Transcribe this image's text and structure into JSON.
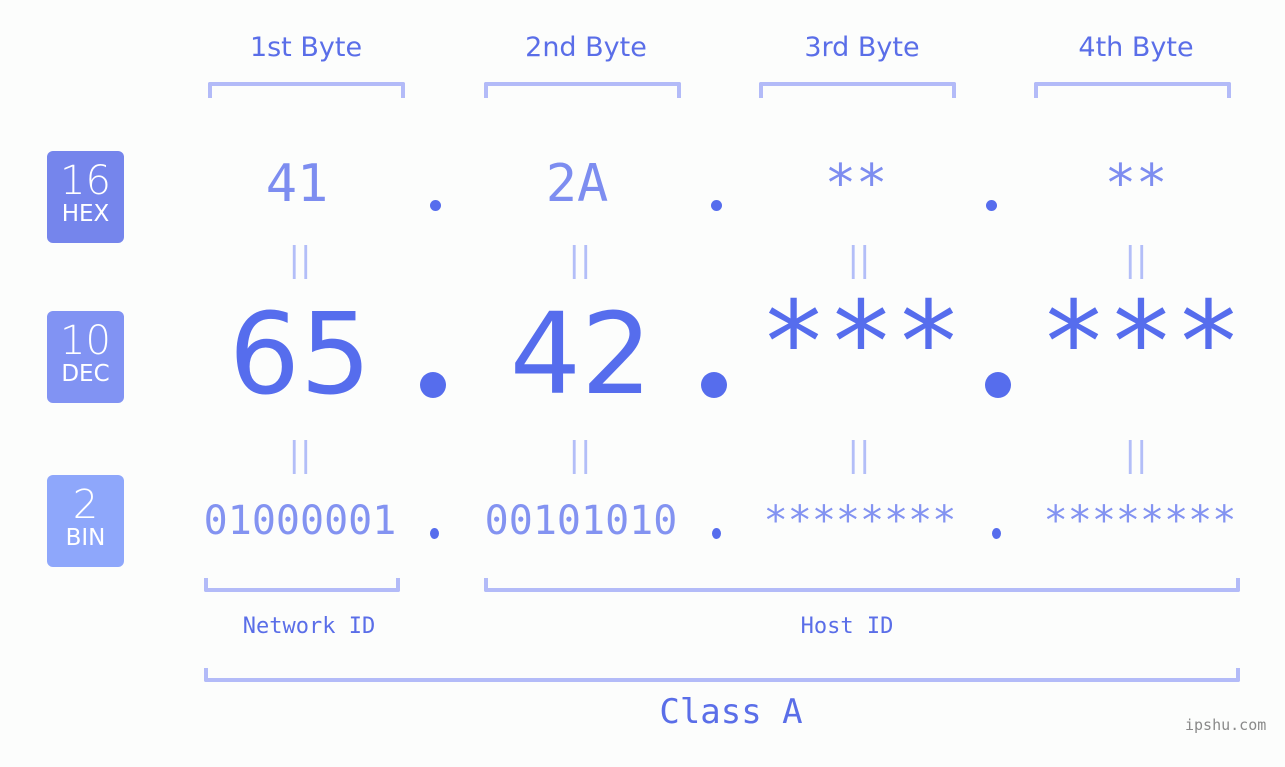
{
  "bytes": [
    {
      "header": "1st Byte",
      "hex": "41",
      "dec": "65",
      "bin": "01000001"
    },
    {
      "header": "2nd Byte",
      "hex": "2A",
      "dec": "42",
      "bin": "00101010"
    },
    {
      "header": "3rd Byte",
      "hex": "**",
      "dec": "***",
      "bin": "********"
    },
    {
      "header": "4th Byte",
      "hex": "**",
      "dec": "***",
      "bin": "********"
    }
  ],
  "bases": [
    {
      "number": "16",
      "label": "HEX",
      "color": "#7585ec"
    },
    {
      "number": "10",
      "label": "DEC",
      "color": "#8193f3"
    },
    {
      "number": "2",
      "label": "BIN",
      "color": "#8ea7fb"
    }
  ],
  "equals_symbol": "||",
  "network_label": "Network ID",
  "host_label": "Host ID",
  "class_label": "Class A",
  "watermark": "ipshu.com",
  "colors": {
    "accent": "#566ded",
    "hex_text": "#7d8df0",
    "bin_text": "#8393f1",
    "bracket": "#b3bbf8",
    "background": "#fcfdfc"
  }
}
